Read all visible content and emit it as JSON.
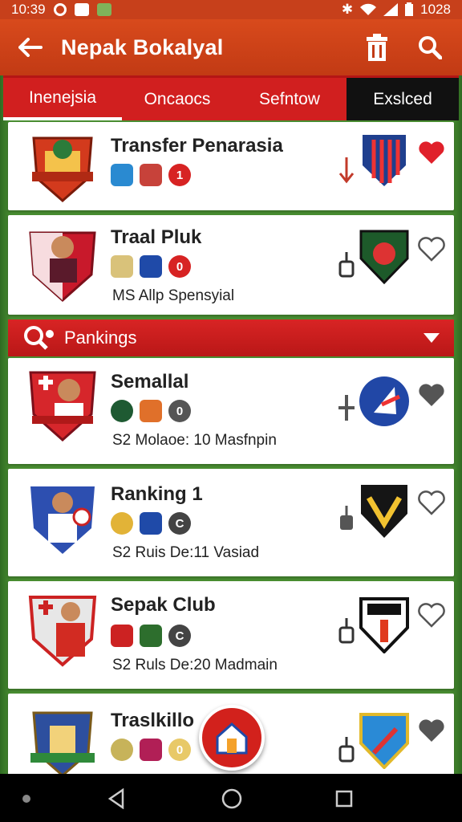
{
  "status_bar": {
    "time": "10:39",
    "battery": "1028"
  },
  "app_bar": {
    "title": "Nepak Bokalyal"
  },
  "tabs": [
    {
      "label": "Inenejsia",
      "active": true
    },
    {
      "label": "Oncaocs",
      "active": false
    },
    {
      "label": "Sefntow",
      "active": false
    },
    {
      "label": "Exslced",
      "active": false
    }
  ],
  "section": {
    "label": "Pankings"
  },
  "cards": [
    {
      "name": "Transfer Penarasia",
      "sub": "",
      "badge_text": "1",
      "favorited": true
    },
    {
      "name": "Traal Pluk",
      "sub": "MS Allp Spensyial",
      "badge_text": "0",
      "favorited": false
    },
    {
      "name": "Semallal",
      "sub": "S2 Molaoe: 10 Masfnpin",
      "badge_text": "0",
      "favorited": true
    },
    {
      "name": "Ranking 1",
      "sub": "S2 Ruis De:11 Vasiad",
      "badge_text": "C",
      "favorited": false
    },
    {
      "name": "Sepak Club",
      "sub": "S2 Ruls De:20 Madmain",
      "badge_text": "C",
      "favorited": false
    },
    {
      "name": "Traslkillo",
      "sub": "",
      "badge_text": "0",
      "favorited": true
    }
  ],
  "colors": {
    "accent": "#d11f1f",
    "app_bar": "#c7401b",
    "dark_tab": "#111111"
  },
  "icons": {
    "back": "arrow-left-icon",
    "delete": "trash-icon",
    "search": "search-icon",
    "section": "search-pin-icon",
    "chevron": "chevron-down-icon",
    "fab": "home-icon",
    "heart": "heart-icon",
    "action": "lever-icon"
  }
}
